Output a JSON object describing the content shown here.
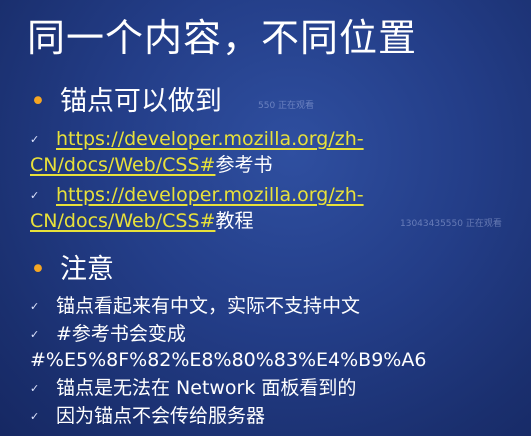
{
  "title": "同一个内容，不同位置",
  "section1": {
    "heading": "锚点可以做到",
    "watermark": "550 正在观看",
    "items": [
      {
        "url_line1": "https://developer.mozilla.org/zh-",
        "url_line2": "CN/docs/Web/CSS#",
        "suffix": "参考书"
      },
      {
        "url_line1": "https://developer.mozilla.org/zh-",
        "url_line2": "CN/docs/Web/CSS#",
        "suffix": "教程"
      }
    ]
  },
  "section2": {
    "heading": "注意",
    "items": [
      "锚点看起来有中文，实际不支持中文",
      "#参考书会变成",
      "#%E5%8F%82%E8%80%83%E4%B9%A6",
      "锚点是无法在 Network 面板看到的",
      "因为锚点不会传给服务器"
    ]
  },
  "watermark": "13043435550 正在观看",
  "bullet_char": "•",
  "check_char": "✓",
  "colors": {
    "background": "#233d87",
    "bullet": "#f5a623",
    "link": "#e8e13a",
    "text": "#ffffff"
  }
}
